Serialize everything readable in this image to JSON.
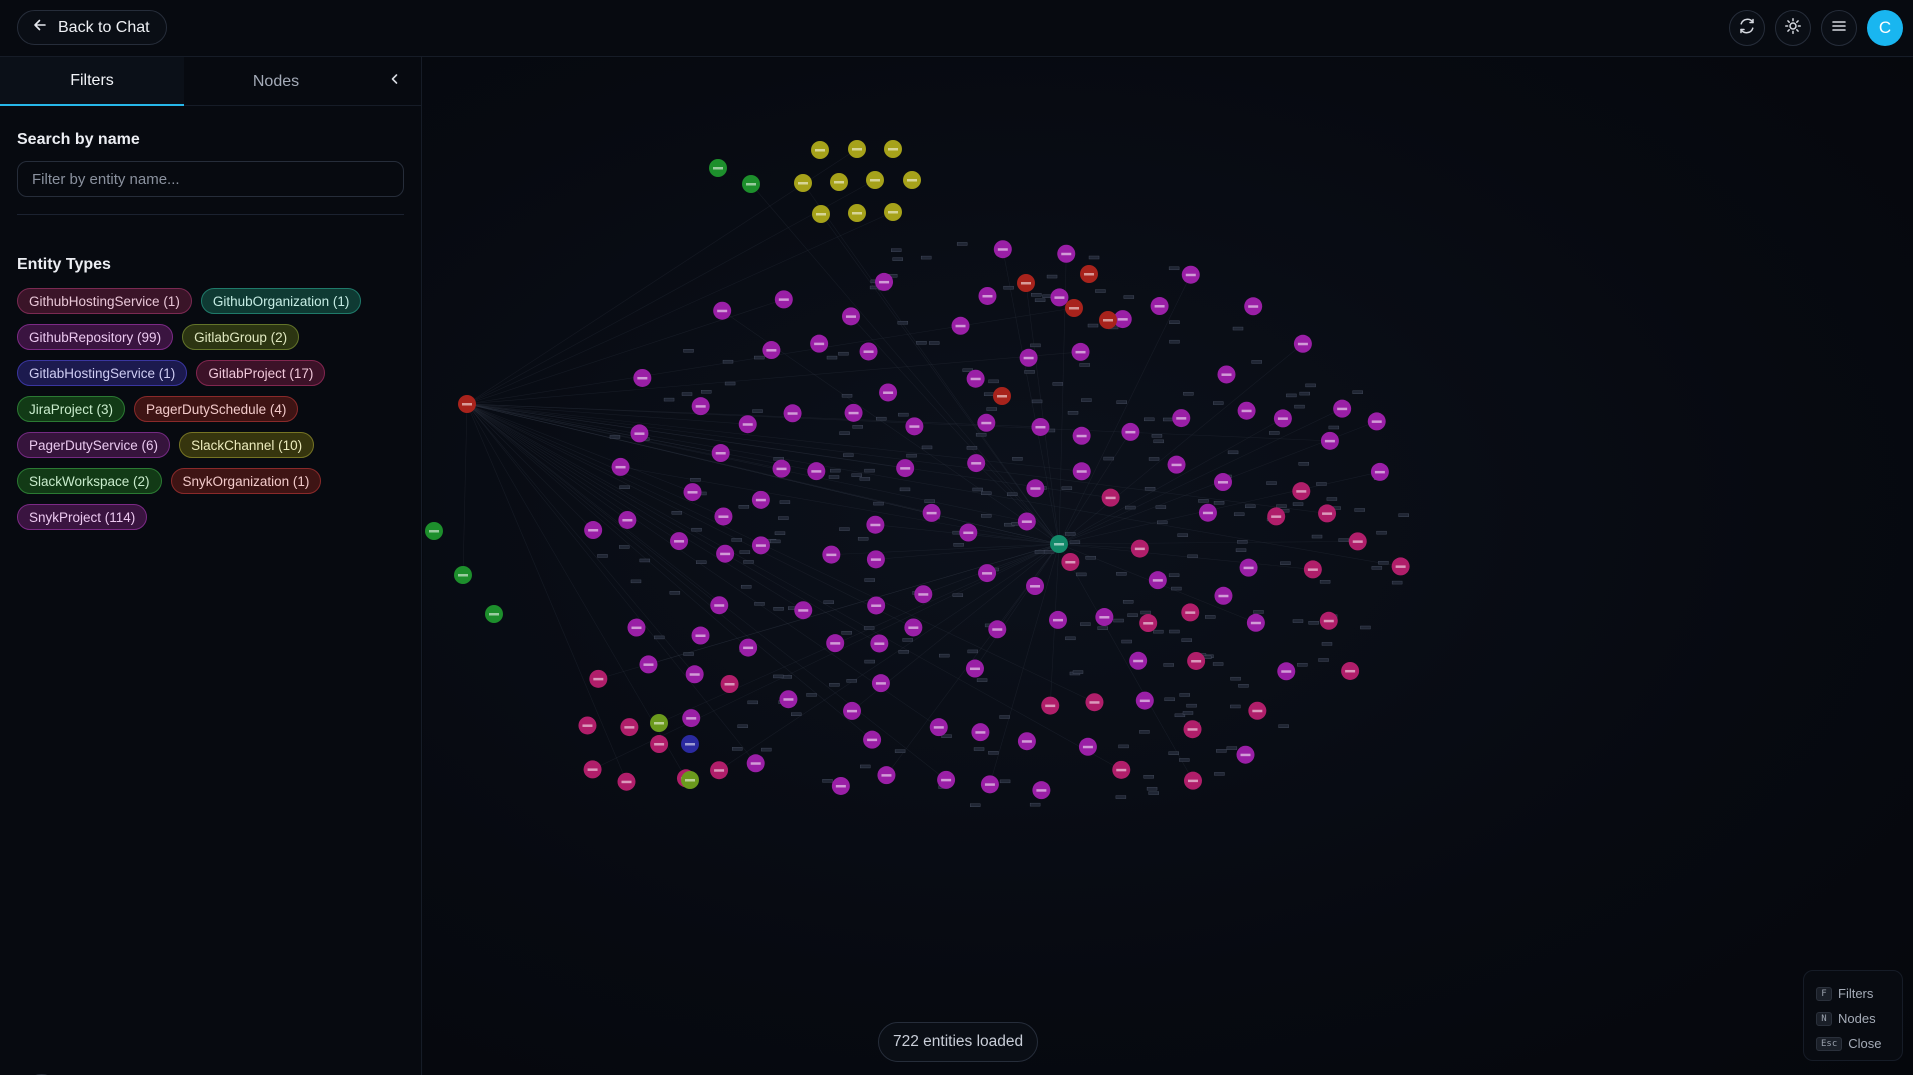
{
  "header": {
    "back_label": "Back to Chat",
    "avatar_initial": "C",
    "icons": [
      "arrow-left-icon",
      "refresh-icon",
      "sun-icon",
      "menu-icon"
    ]
  },
  "sidebar": {
    "tabs": [
      {
        "label": "Filters",
        "active": true
      },
      {
        "label": "Nodes",
        "active": false
      }
    ],
    "search_title": "Search by name",
    "search_placeholder": "Filter by entity name...",
    "search_value": "",
    "entity_types_title": "Entity Types",
    "entity_types": [
      {
        "label": "GithubHostingService (1)",
        "bg": "#3a1428",
        "border": "#7a2a52",
        "text": "#e9c7d8"
      },
      {
        "label": "GithubOrganization (1)",
        "bg": "#0f3a33",
        "border": "#1f7a6a",
        "text": "#c6ece4"
      },
      {
        "label": "GithubRepository (99)",
        "bg": "#3a1440",
        "border": "#7c2a86",
        "text": "#ecc9f0"
      },
      {
        "label": "GitlabGroup (2)",
        "bg": "#2c3512",
        "border": "#63742a",
        "text": "#e0e8c0"
      },
      {
        "label": "GitlabHostingService (1)",
        "bg": "#1c1a4e",
        "border": "#3a36a0",
        "text": "#cfcdf3"
      },
      {
        "label": "GitlabProject (17)",
        "bg": "#3c1228",
        "border": "#82264f",
        "text": "#f0c8da"
      },
      {
        "label": "JiraProject (3)",
        "bg": "#123a16",
        "border": "#2b7a33",
        "text": "#c9eccc"
      },
      {
        "label": "PagerDutySchedule (4)",
        "bg": "#3e1414",
        "border": "#8a2a2a",
        "text": "#f2caca"
      },
      {
        "label": "PagerDutyService (6)",
        "bg": "#36143c",
        "border": "#742a82",
        "text": "#eac9ef"
      },
      {
        "label": "SlackChannel (10)",
        "bg": "#36350e",
        "border": "#767424",
        "text": "#ecebbd"
      },
      {
        "label": "SlackWorkspace (2)",
        "bg": "#123a16",
        "border": "#2b7a33",
        "text": "#c9eccc"
      },
      {
        "label": "SnykOrganization (1)",
        "bg": "#3e1414",
        "border": "#8a2a2a",
        "text": "#f2caca"
      },
      {
        "label": "SnykProject (114)",
        "bg": "#3a1440",
        "border": "#7c2a86",
        "text": "#ecc9f0"
      }
    ],
    "bottom_badge": "N"
  },
  "graph": {
    "colors": {
      "purple": "#9a1fa6",
      "magenta": "#b01e6a",
      "yellow": "#a6a21a",
      "green": "#1d8f2c",
      "red": "#a8231c",
      "teal": "#138a6a",
      "blue": "#2b2aa0",
      "lime": "#6b9a1d"
    }
  },
  "status": {
    "entities_loaded": "722 entities loaded"
  },
  "shortcuts": [
    {
      "key": "F",
      "label": "Filters"
    },
    {
      "key": "N",
      "label": "Nodes"
    },
    {
      "key": "Esc",
      "label": "Close"
    }
  ]
}
